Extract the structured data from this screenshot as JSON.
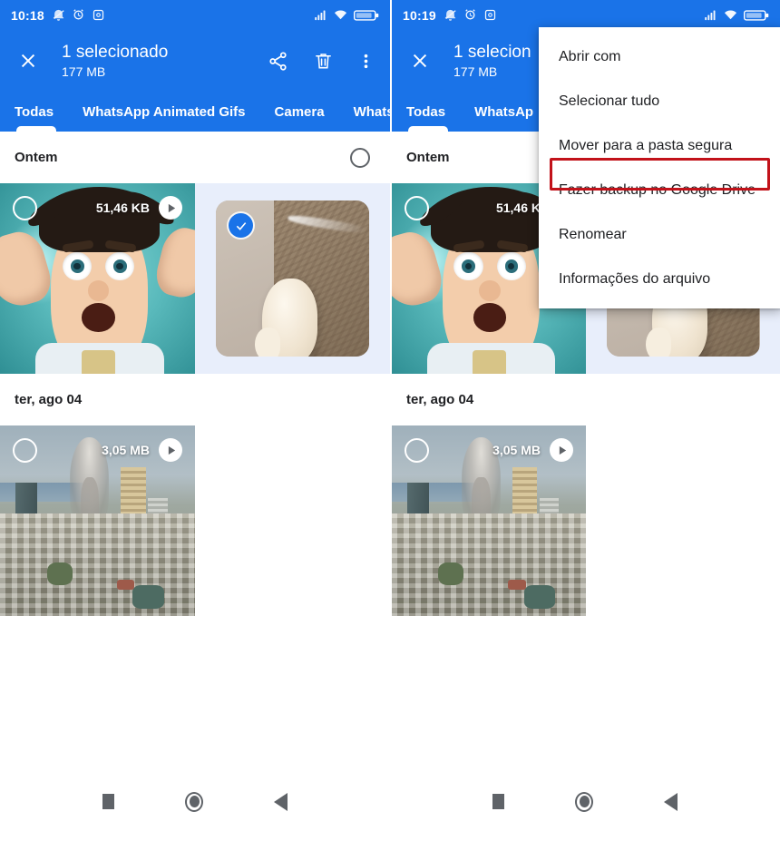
{
  "theme": {
    "accent": "#1a73e8",
    "highlight_red": "#c2121a",
    "selected_bg": "#e8eefb",
    "text_primary": "#202124",
    "nav_icon": "#5f6368"
  },
  "panels": [
    {
      "id": "left",
      "status_bar": {
        "time": "10:18",
        "left_icons": [
          "mute-icon",
          "alarm-icon",
          "instagram-icon"
        ],
        "right_icons": [
          "signal-icon",
          "wifi-icon",
          "battery-icon"
        ],
        "battery_level": "70"
      },
      "appbar": {
        "close_icon": "close-icon",
        "title": "1 selecionado",
        "subtitle": "177 MB",
        "share_icon": "share-icon",
        "delete_icon": "trash-icon",
        "overflow_icon": "more-vertical-icon"
      },
      "tabs": [
        {
          "label": "Todas",
          "active": true
        },
        {
          "label": "WhatsApp Animated Gifs",
          "active": false
        },
        {
          "label": "Camera",
          "active": false
        },
        {
          "label": "Whats",
          "active": false
        }
      ],
      "sections": [
        {
          "date_label": "Ontem",
          "has_select_circle": true,
          "items": [
            {
              "art": "cartoon",
              "size": "51,46 KB",
              "is_video": true,
              "selected": false
            },
            {
              "art": "dog",
              "size": "",
              "is_video": false,
              "selected": true
            }
          ]
        },
        {
          "date_label": "ter, ago 04",
          "has_select_circle": false,
          "items": [
            {
              "art": "city",
              "size": "3,05 MB",
              "is_video": true,
              "selected": false
            }
          ]
        }
      ],
      "menu_open": false
    },
    {
      "id": "right",
      "status_bar": {
        "time": "10:19",
        "left_icons": [
          "mute-icon",
          "alarm-icon",
          "instagram-icon"
        ],
        "right_icons": [
          "signal-icon",
          "wifi-icon",
          "battery-icon"
        ],
        "battery_level": "70"
      },
      "appbar": {
        "close_icon": "close-icon",
        "title": "1 selecion",
        "subtitle": "177 MB",
        "share_icon": "share-icon",
        "delete_icon": "trash-icon",
        "overflow_icon": "more-vertical-icon"
      },
      "tabs": [
        {
          "label": "Todas",
          "active": true
        },
        {
          "label": "WhatsAp",
          "active": false
        }
      ],
      "sections": [
        {
          "date_label": "Ontem",
          "has_select_circle": false,
          "items": [
            {
              "art": "cartoon",
              "size": "51,46 K",
              "is_video": false,
              "selected": false
            },
            {
              "art": "dog",
              "size": "",
              "is_video": false,
              "selected": true
            }
          ]
        },
        {
          "date_label": "ter, ago 04",
          "has_select_circle": false,
          "items": [
            {
              "art": "city",
              "size": "3,05 MB",
              "is_video": true,
              "selected": false
            }
          ]
        }
      ],
      "menu_open": true,
      "menu": {
        "items": [
          {
            "label": "Abrir com",
            "highlighted": false
          },
          {
            "label": "Selecionar tudo",
            "highlighted": false
          },
          {
            "label": "Mover para a pasta segura",
            "highlighted": true
          },
          {
            "label": "Fazer backup no Google Drive",
            "highlighted": false
          },
          {
            "label": "Renomear",
            "highlighted": false
          },
          {
            "label": "Informações do arquivo",
            "highlighted": false
          }
        ]
      }
    }
  ],
  "navbar": {
    "buttons": [
      {
        "name": "recents-button",
        "icon": "square-icon"
      },
      {
        "name": "home-button",
        "icon": "circle-icon"
      },
      {
        "name": "back-button",
        "icon": "triangle-back-icon"
      }
    ]
  }
}
